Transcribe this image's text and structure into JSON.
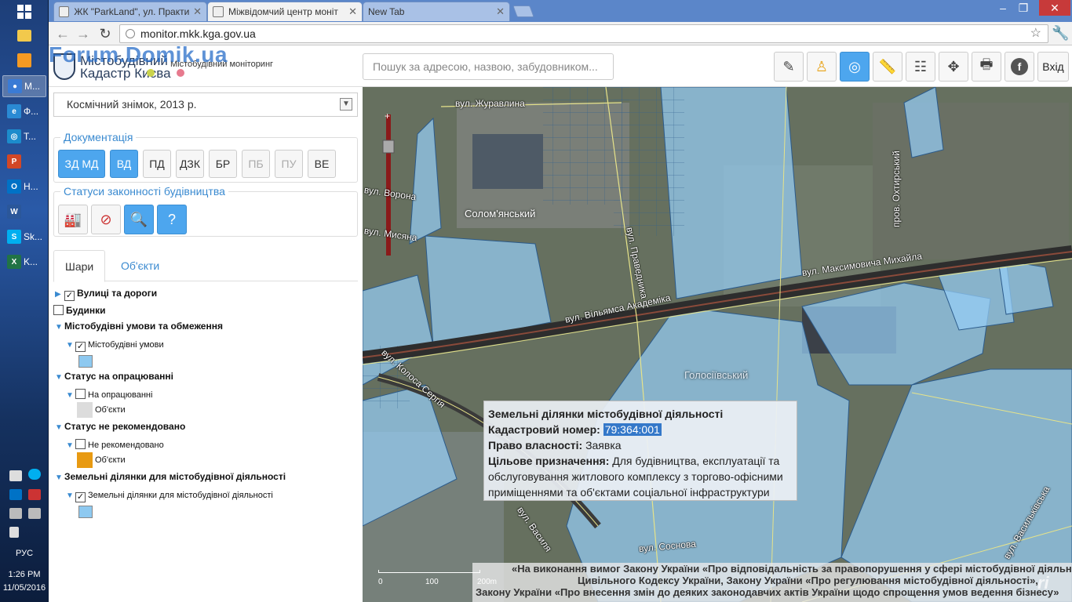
{
  "taskbar": {
    "apps": [
      {
        "label": "M...",
        "icon": "chrome-icon",
        "color": "#3a7bd5"
      },
      {
        "label": "Ф...",
        "icon": "ie-icon",
        "color": "#2a8ad4"
      },
      {
        "label": "T...",
        "icon": "browser-icon",
        "color": "#1c8ccc"
      },
      {
        "label": "",
        "icon": "powerpoint-icon",
        "color": "#d24726"
      },
      {
        "label": "H...",
        "icon": "outlook-icon",
        "color": "#0072c6"
      },
      {
        "label": "",
        "icon": "word-icon",
        "color": "#2b579a"
      },
      {
        "label": "Sk...",
        "icon": "skype-icon",
        "color": "#00aff0"
      },
      {
        "label": "K...",
        "icon": "excel-icon",
        "color": "#217346"
      }
    ],
    "language": "РУС",
    "time": "1:26 PM",
    "date": "11/05/2016"
  },
  "browser": {
    "tabs": [
      {
        "title": "ЖК \"ParkLand\", ул. Практи"
      },
      {
        "title": "Міжвідомчий центр моніт"
      },
      {
        "title": "New Tab"
      }
    ],
    "url": "monitor.mkk.kga.gov.ua"
  },
  "header": {
    "logo_line1": "Містобудівний",
    "logo_line2": "Кадастр Києва",
    "logo_sub": "Містобудівний моніторинг",
    "watermark": "Forum.Domik.ua",
    "search_placeholder": "Пошук за адресою, назвою, забудовником...",
    "exit_label": "Вхід"
  },
  "sidebar": {
    "basemap": "Космічний знімок, 2013 р.",
    "documentation_title": "Документація",
    "doc_buttons": [
      {
        "label": "ЗД МД",
        "state": "on"
      },
      {
        "label": "ВД",
        "state": "on"
      },
      {
        "label": "ПД",
        "state": "normal"
      },
      {
        "label": "ДЗК",
        "state": "normal"
      },
      {
        "label": "БР",
        "state": "normal"
      },
      {
        "label": "ПБ",
        "state": "disabled"
      },
      {
        "label": "ПУ",
        "state": "disabled"
      },
      {
        "label": "ВЕ",
        "state": "normal"
      }
    ],
    "legality_title": "Статуси законності будівництва",
    "tabs": {
      "layers": "Шари",
      "objects": "Об'єкти"
    },
    "layers": {
      "streets": "Вулиці та дороги",
      "buildings": "Будинки",
      "urban_conditions_group": "Містобудівні умови та обмеження",
      "urban_conditions": "Містобудівні умови",
      "processing_group": "Статус на опрацюванні",
      "processing": "На опрацюванні",
      "processing_objects": "Об'єкти",
      "not_recommended_group": "Статус не рекомендовано",
      "not_recommended": "Не рекомендовано",
      "not_recommended_objects": "Об'єкти",
      "land_plots_group": "Земельні ділянки для містобудівної діяльності",
      "land_plots": "Земельні ділянки для містобудівної діяльності"
    },
    "colors": {
      "light_blue": "#8ec9f0",
      "gray": "#dcdcdc",
      "orange": "#e89a12"
    }
  },
  "map": {
    "streets": {
      "zhuravlyna": "вул. Журавлина",
      "vorona": "вул. Ворона",
      "mysliana": "вул. Мисяна",
      "pravdychna": "вул. Праведника",
      "vilyamsa": "вул. Вільямса Академіка",
      "maksymovycha": "вул. Максимовича Михайла",
      "okhtyrskyi": "пров. Охтирський",
      "kolosa": "вул. Колоса Сергія",
      "vasylya": "вул. Василя",
      "sosnova": "вул. Соснова",
      "vasylkivska": "вул. Васильківська"
    },
    "districts": {
      "solomianskyi": "Солом'янський",
      "holosiivskyi": "Голосіївський"
    },
    "popup": {
      "title": "Земельні ділянки містобудівної діяльності",
      "cadastral_label": "Кадастровий номер:",
      "cadastral_value": "79:364:001",
      "ownership_label": "Право власності:",
      "ownership_value": "Заявка",
      "purpose_label": "Цільове призначення:",
      "purpose_value": "Для будівництва, експлуатації та обслуговування житлового комплексу з торгово-офісними приміщеннями та об'єктами соціальної інфраструктури"
    },
    "scale": {
      "s0": "0",
      "s100": "100",
      "s200": "200m"
    },
    "attribution": {
      "line1": "«На виконання вимог Закону України «Про відповідальність за правопорушення у сфері містобудівної діяльності»",
      "line2": "Цивільного Кодексу України, Закону України «Про регулювання містобудівної діяльності»,",
      "line3": "Закону України «Про внесення змін до деяких законодавчих актів України щодо спрощення умов ведення бізнесу»"
    }
  }
}
